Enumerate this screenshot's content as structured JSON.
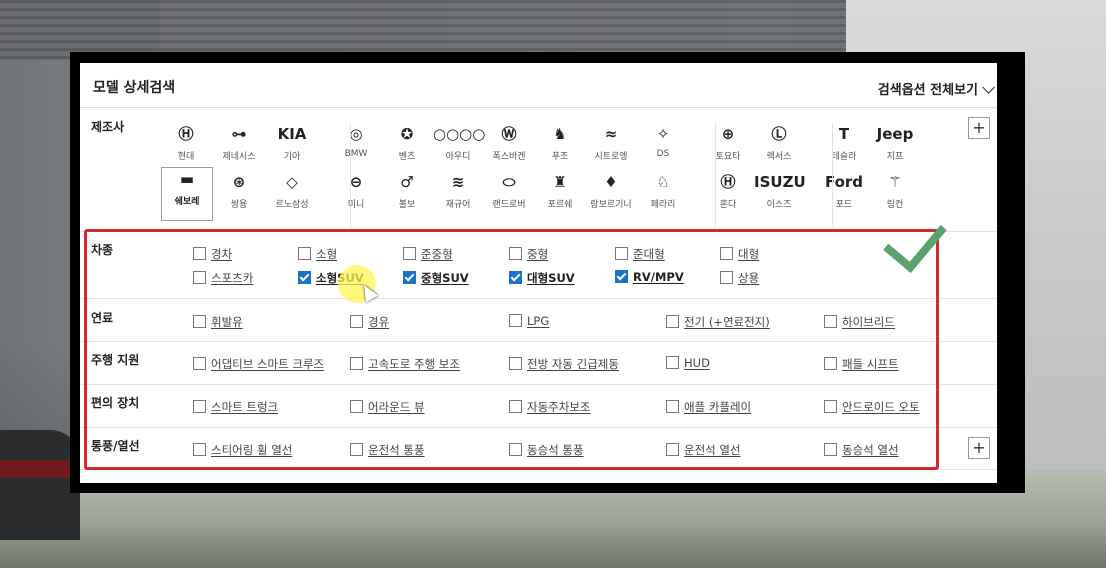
{
  "panel": {
    "title": "모델 상세검색",
    "view_all": "검색옵션 전체보기"
  },
  "manufacturer": {
    "label": "제조사",
    "brands": [
      {
        "name": "현대",
        "logo": "Ⓗ"
      },
      {
        "name": "제네시스",
        "logo": "⊶"
      },
      {
        "name": "기아",
        "logo": "KIA"
      },
      {
        "name": "BMW",
        "logo": "◎"
      },
      {
        "name": "벤츠",
        "logo": "✪"
      },
      {
        "name": "아우디",
        "logo": "○○○○"
      },
      {
        "name": "폭스바겐",
        "logo": "Ⓦ"
      },
      {
        "name": "푸조",
        "logo": "♞"
      },
      {
        "name": "시트로엥",
        "logo": "≈"
      },
      {
        "name": "DS",
        "logo": "✧"
      },
      {
        "name": "토요타",
        "logo": "⊕"
      },
      {
        "name": "렉서스",
        "logo": "Ⓛ"
      },
      {
        "name": "테슬라",
        "logo": "T"
      },
      {
        "name": "지프",
        "logo": "Jeep"
      },
      {
        "name": "쉐보레",
        "logo": "▬"
      },
      {
        "name": "쌍용",
        "logo": "⊛"
      },
      {
        "name": "르노삼성",
        "logo": "◇"
      },
      {
        "name": "미니",
        "logo": "⊖"
      },
      {
        "name": "볼보",
        "logo": "♂"
      },
      {
        "name": "재규어",
        "logo": "≋"
      },
      {
        "name": "랜드로버",
        "logo": "⬭"
      },
      {
        "name": "포르쉐",
        "logo": "♜"
      },
      {
        "name": "람보르기니",
        "logo": "♦"
      },
      {
        "name": "페라리",
        "logo": "♘"
      },
      {
        "name": "혼다",
        "logo": "Ⓗ"
      },
      {
        "name": "이스즈",
        "logo": "ISUZU"
      },
      {
        "name": "포드",
        "logo": "Ford"
      },
      {
        "name": "링컨",
        "logo": "⚚"
      }
    ]
  },
  "vehicle_type": {
    "label": "차종",
    "options": [
      {
        "label": "경차",
        "checked": false
      },
      {
        "label": "소형",
        "checked": false
      },
      {
        "label": "준중형",
        "checked": false
      },
      {
        "label": "중형",
        "checked": false
      },
      {
        "label": "준대형",
        "checked": false
      },
      {
        "label": "대형",
        "checked": false
      },
      {
        "label": "스포츠카",
        "checked": false
      },
      {
        "label": "소형SUV",
        "checked": true
      },
      {
        "label": "중형SUV",
        "checked": true
      },
      {
        "label": "대형SUV",
        "checked": true
      },
      {
        "label": "RV/MPV",
        "checked": true
      },
      {
        "label": "상용",
        "checked": false
      }
    ]
  },
  "fuel": {
    "label": "연료",
    "options": [
      "휘발유",
      "경유",
      "LPG",
      "전기 (+연료전지)",
      "하이브리드"
    ]
  },
  "driving_assist": {
    "label": "주행 지원",
    "options": [
      "어댑티브 스마트 크루즈",
      "고속도로 주행 보조",
      "전방 자동 긴급제동",
      "HUD",
      "패들 시프트"
    ]
  },
  "convenience": {
    "label": "편의 장치",
    "options": [
      "스마트 트렁크",
      "어라운드 뷰",
      "자동주차보조",
      "애플 카플레이",
      "안드로이드 오토"
    ]
  },
  "ventilation": {
    "label": "통풍/열선",
    "options": [
      "스티어링 휠 열선",
      "운전석 통풍",
      "동승석 통풍",
      "운전석 열선",
      "동승석 열선"
    ]
  },
  "colors": {
    "accent": "#1a73c8",
    "highlight_border": "#d2282e",
    "check_mark": "#5aa36e"
  }
}
